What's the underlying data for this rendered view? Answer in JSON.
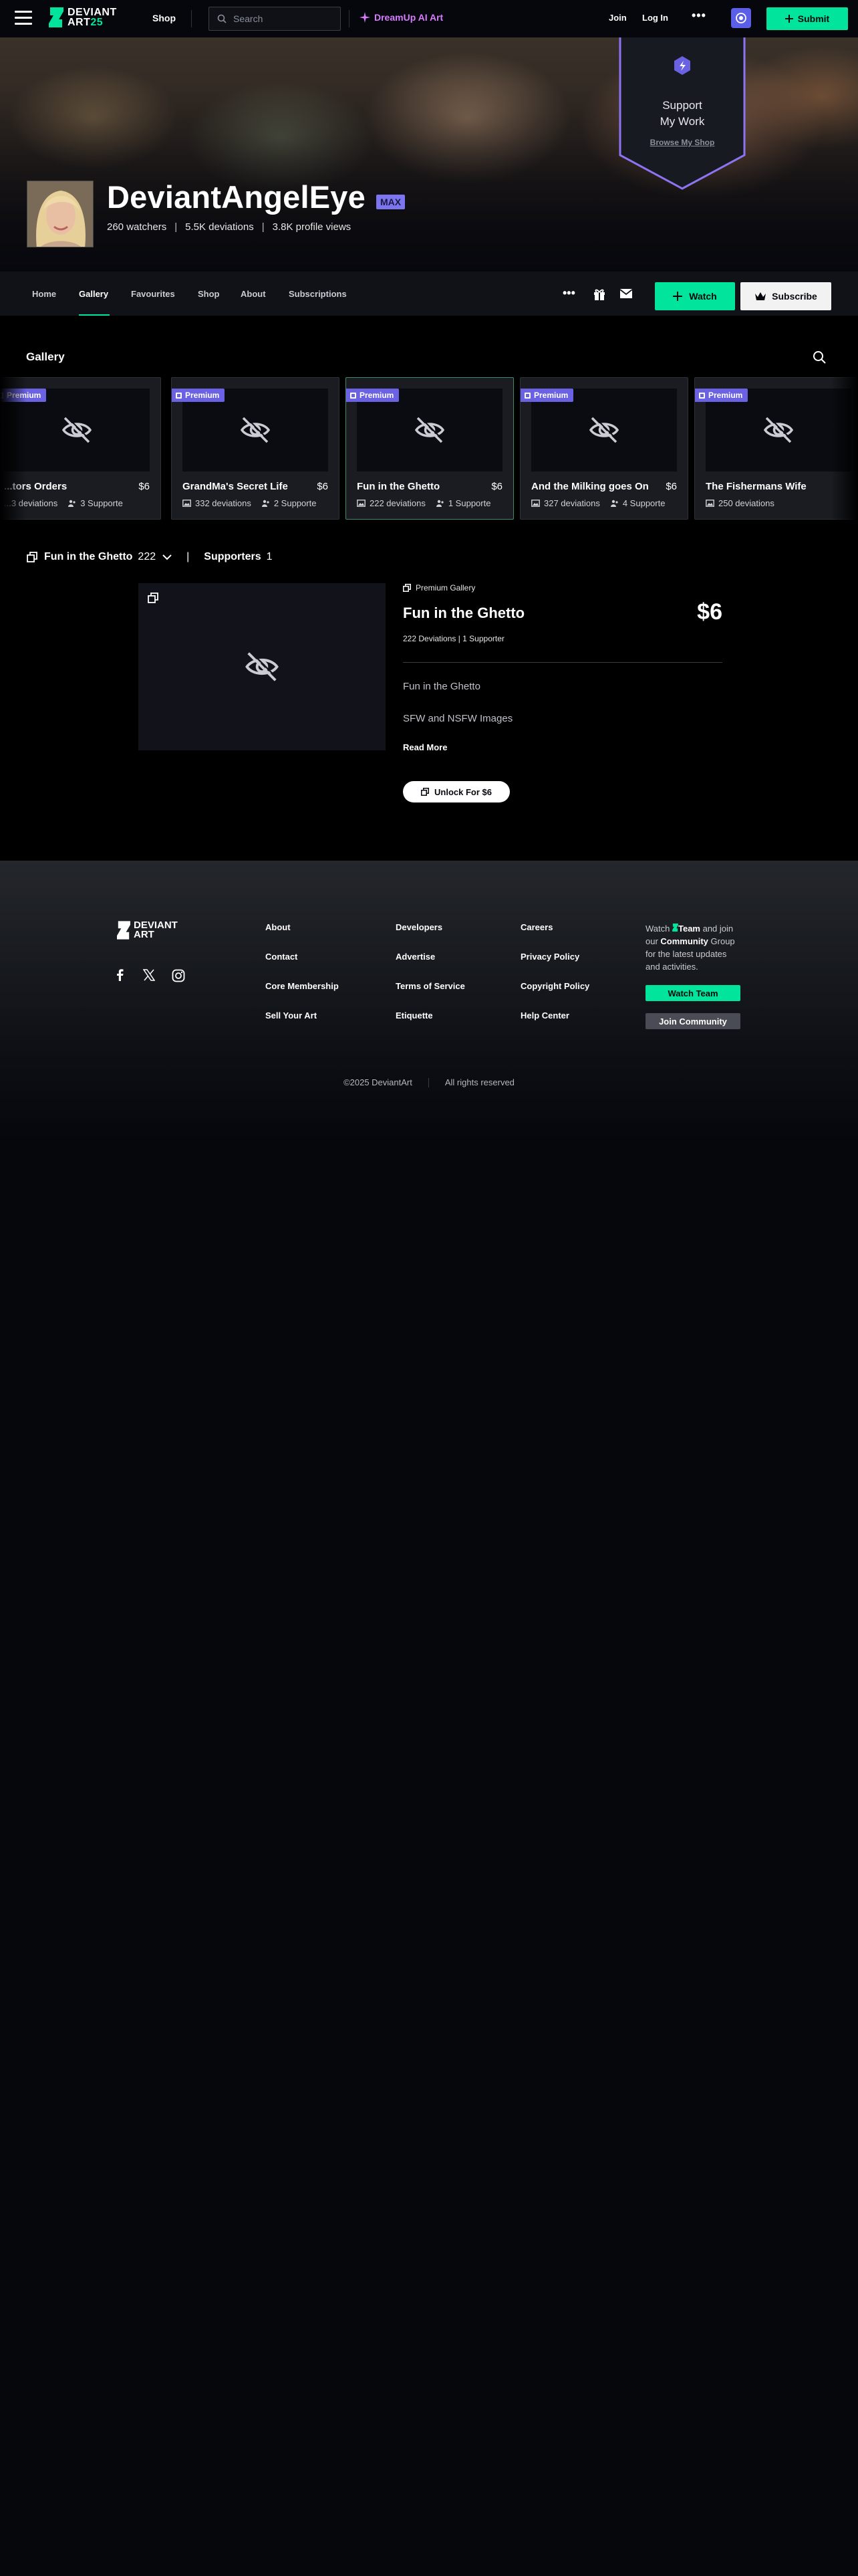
{
  "topbar": {
    "logo_line1": "DEVIANT",
    "logo_line2a": "ART",
    "logo_line2b": "25",
    "shop": "Shop",
    "search_placeholder": "Search",
    "dreamup": "DreamUp AI Art",
    "join": "Join",
    "login": "Log In",
    "more": "•••",
    "submit": "Submit"
  },
  "hero": {
    "support_line1": "Support",
    "support_line2": "My Work",
    "browse_shop": "Browse My Shop",
    "username": "DeviantAngelEye",
    "badge": "MAX",
    "watchers": "260 watchers",
    "deviations": "5.5K deviations",
    "views": "3.8K profile views",
    "stat_sep": "|"
  },
  "tabs": {
    "items": [
      "Home",
      "Gallery",
      "Favourites",
      "Shop",
      "About",
      "Subscriptions"
    ],
    "more": "•••",
    "watch": "Watch",
    "subscribe": "Subscribe"
  },
  "gallery": {
    "title": "Gallery",
    "premium_label": "Premium",
    "cards": [
      {
        "title": "...tors Orders",
        "price": "$6",
        "deviations": "...3 deviations",
        "supporters": "3 Supporte"
      },
      {
        "title": "GrandMa's Secret Life",
        "price": "$6",
        "deviations": "332 deviations",
        "supporters": "2 Supporte"
      },
      {
        "title": "Fun in the Ghetto",
        "price": "$6",
        "deviations": "222 deviations",
        "supporters": "1 Supporte"
      },
      {
        "title": "And the Milking goes On",
        "price": "$6",
        "deviations": "327 deviations",
        "supporters": "4 Supporte"
      },
      {
        "title": "The Fishermans Wife",
        "price": "",
        "deviations": "250 deviations",
        "supporters": ""
      }
    ],
    "crumb_title": "Fun in the Ghetto",
    "crumb_count": "222",
    "crumb_sep": "|",
    "supporters_label": "Supporters",
    "supporters_count": "1"
  },
  "detail": {
    "premium_gallery": "Premium Gallery",
    "title": "Fun in the Ghetto",
    "price": "$6",
    "meta": "222 Deviations | 1 Supporter",
    "desc1": "Fun in the Ghetto",
    "desc2": "SFW and NSFW Images",
    "read_more": "Read More",
    "unlock": "Unlock For $6"
  },
  "footer": {
    "logo_line1": "DEVIANT",
    "logo_line2": "ART",
    "col1": [
      "About",
      "Contact",
      "Core Membership",
      "Sell Your Art"
    ],
    "col2": [
      "Developers",
      "Advertise",
      "Terms of Service",
      "Etiquette"
    ],
    "col3": [
      "Careers",
      "Privacy Policy",
      "Copyright Policy",
      "Help Center"
    ],
    "watch_text_1": "Watch ",
    "watch_team": "Team",
    "watch_text_2": " and join our ",
    "watch_community": "Community",
    "watch_text_3": " Group for the latest updates and activities.",
    "watch_team_btn": "Watch Team",
    "join_community_btn": "Join Community",
    "copyright": "©2025 DeviantArt",
    "rights": "All rights reserved"
  },
  "colors": {
    "accent": "#00e59b",
    "premium": "#6a62e2",
    "dreamup": "#d77bff"
  }
}
